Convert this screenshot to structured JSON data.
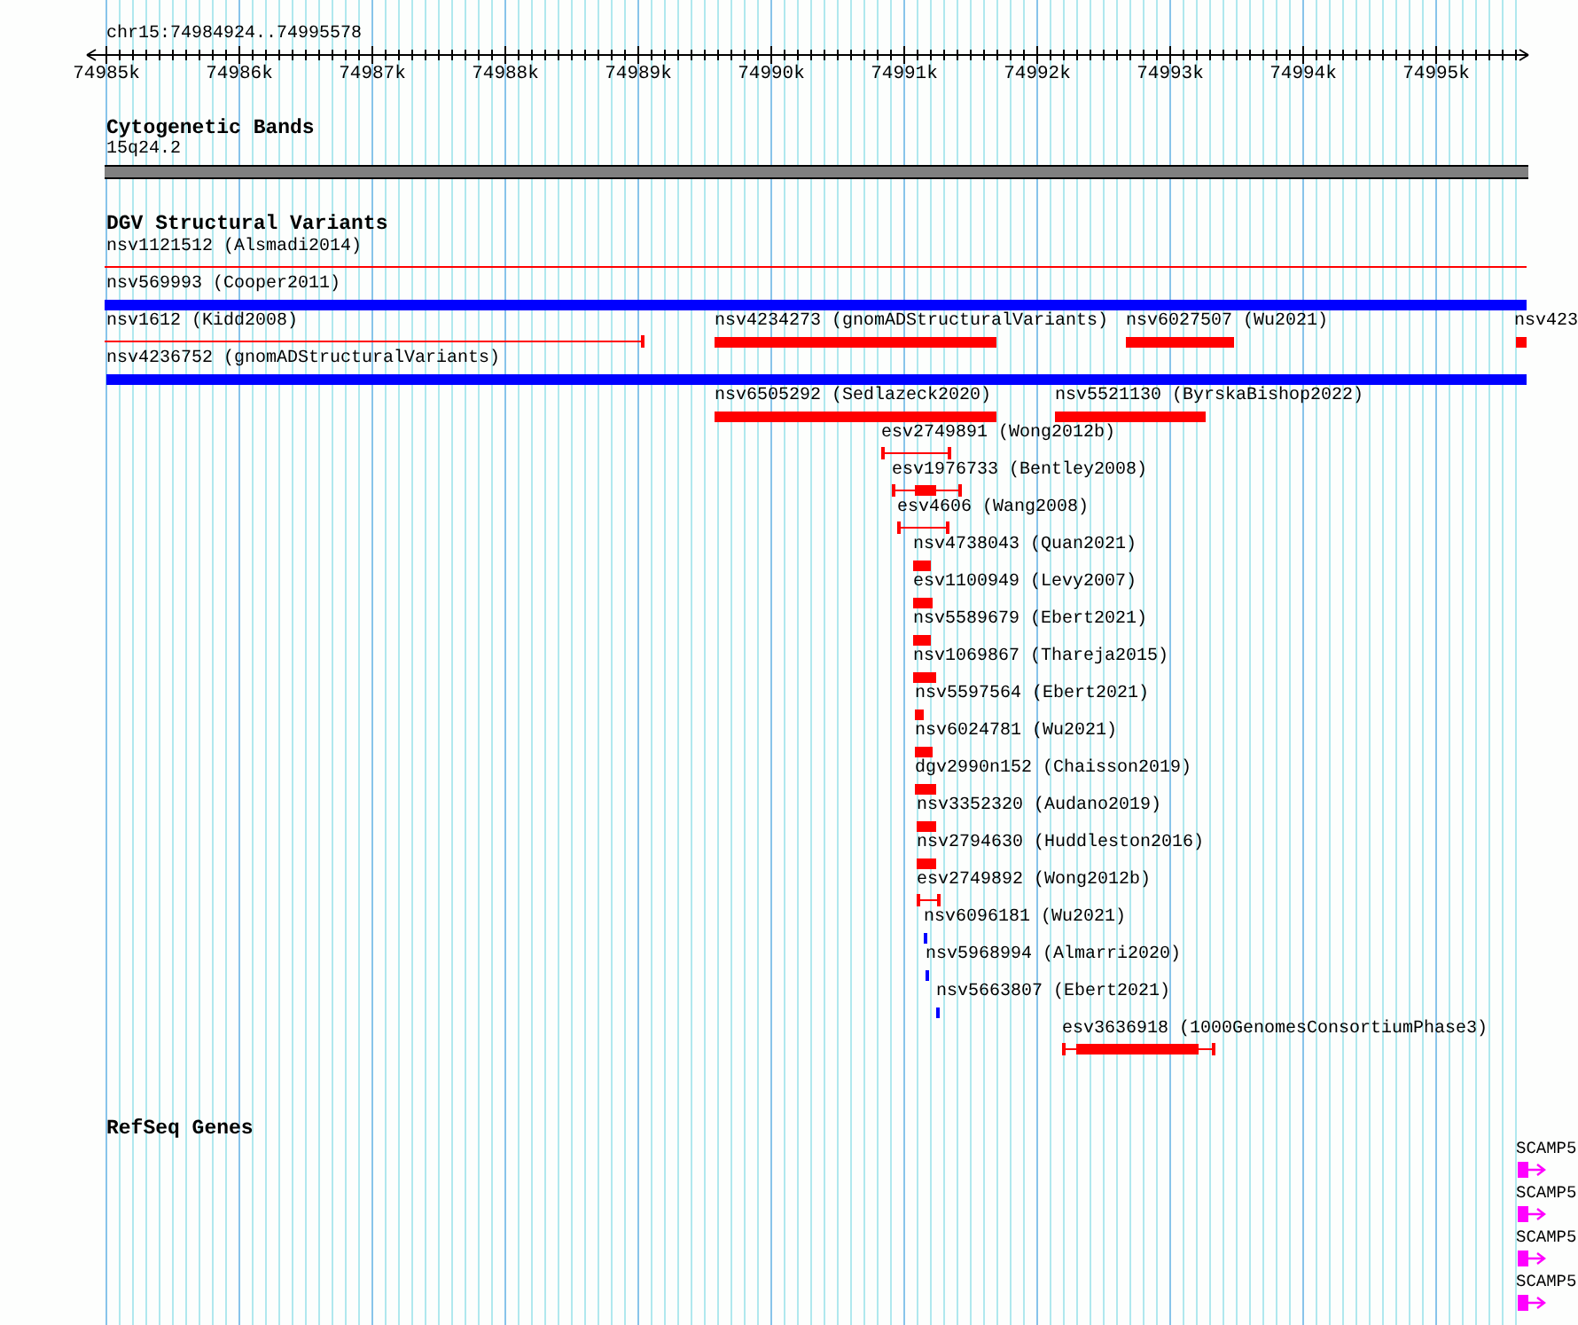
{
  "ruler": {
    "title": "chr15:74984924..74995578",
    "ticks": [
      "74985k",
      "74986k",
      "74987k",
      "74988k",
      "74989k",
      "74990k",
      "74991k",
      "74992k",
      "74993k",
      "74994k",
      "74995k"
    ]
  },
  "cytogenetic_bands": {
    "title": "Cytogenetic Bands",
    "band": "15q24.2"
  },
  "dgv": {
    "title": "DGV Structural Variants",
    "features": [
      {
        "label": "nsv1121512 (Alsmadi2014)",
        "kind": "line",
        "color": "#ff0000"
      },
      {
        "label": "nsv569993 (Cooper2011)",
        "kind": "bar",
        "color": "#0000ff"
      },
      {
        "label": "nsv1612 (Kidd2008)",
        "kind": "line-end",
        "color": "#ff0000"
      },
      {
        "label": "nsv4234273 (gnomADStructuralVariants)",
        "kind": "bar",
        "color": "#ff0000"
      },
      {
        "label": "nsv6027507 (Wu2021)",
        "kind": "bar",
        "color": "#ff0000"
      },
      {
        "label": "nsv423",
        "kind": "bar",
        "color": "#ff0000"
      },
      {
        "label": "nsv4236752 (gnomADStructuralVariants)",
        "kind": "bar",
        "color": "#0000ff"
      },
      {
        "label": "nsv6505292 (Sedlazeck2020)",
        "kind": "bar",
        "color": "#ff0000"
      },
      {
        "label": "nsv5521130 (ByrskaBishop2022)",
        "kind": "bar",
        "color": "#ff0000"
      },
      {
        "label": "esv2749891 (Wong2012b)",
        "kind": "whisker",
        "color": "#ff0000"
      },
      {
        "label": "esv1976733 (Bentley2008)",
        "kind": "whisker",
        "color": "#ff0000"
      },
      {
        "label": "esv4606 (Wang2008)",
        "kind": "whisker",
        "color": "#ff0000"
      },
      {
        "label": "nsv4738043 (Quan2021)",
        "kind": "bar",
        "color": "#ff0000"
      },
      {
        "label": "esv1100949 (Levy2007)",
        "kind": "bar",
        "color": "#ff0000"
      },
      {
        "label": "nsv5589679 (Ebert2021)",
        "kind": "bar",
        "color": "#ff0000"
      },
      {
        "label": "nsv1069867 (Thareja2015)",
        "kind": "bar",
        "color": "#ff0000"
      },
      {
        "label": "nsv5597564 (Ebert2021)",
        "kind": "bar",
        "color": "#ff0000"
      },
      {
        "label": "nsv6024781 (Wu2021)",
        "kind": "bar",
        "color": "#ff0000"
      },
      {
        "label": "dgv2990n152 (Chaisson2019)",
        "kind": "bar",
        "color": "#ff0000"
      },
      {
        "label": "nsv3352320 (Audano2019)",
        "kind": "bar",
        "color": "#ff0000"
      },
      {
        "label": "nsv2794630 (Huddleston2016)",
        "kind": "bar",
        "color": "#ff0000"
      },
      {
        "label": "esv2749892 (Wong2012b)",
        "kind": "whisker",
        "color": "#ff0000"
      },
      {
        "label": "nsv6096181 (Wu2021)",
        "kind": "bar",
        "color": "#0000ff"
      },
      {
        "label": "nsv5968994 (Almarri2020)",
        "kind": "bar",
        "color": "#0000ff"
      },
      {
        "label": "nsv5663807 (Ebert2021)",
        "kind": "bar",
        "color": "#0000ff"
      },
      {
        "label": "esv3636918 (1000GenomesConsortiumPhase3)",
        "kind": "whisker",
        "color": "#ff0000"
      }
    ]
  },
  "refseq": {
    "title": "RefSeq Genes",
    "genes": [
      {
        "label": "SCAMP5"
      },
      {
        "label": "SCAMP5"
      },
      {
        "label": "SCAMP5"
      },
      {
        "label": "SCAMP5"
      }
    ]
  }
}
